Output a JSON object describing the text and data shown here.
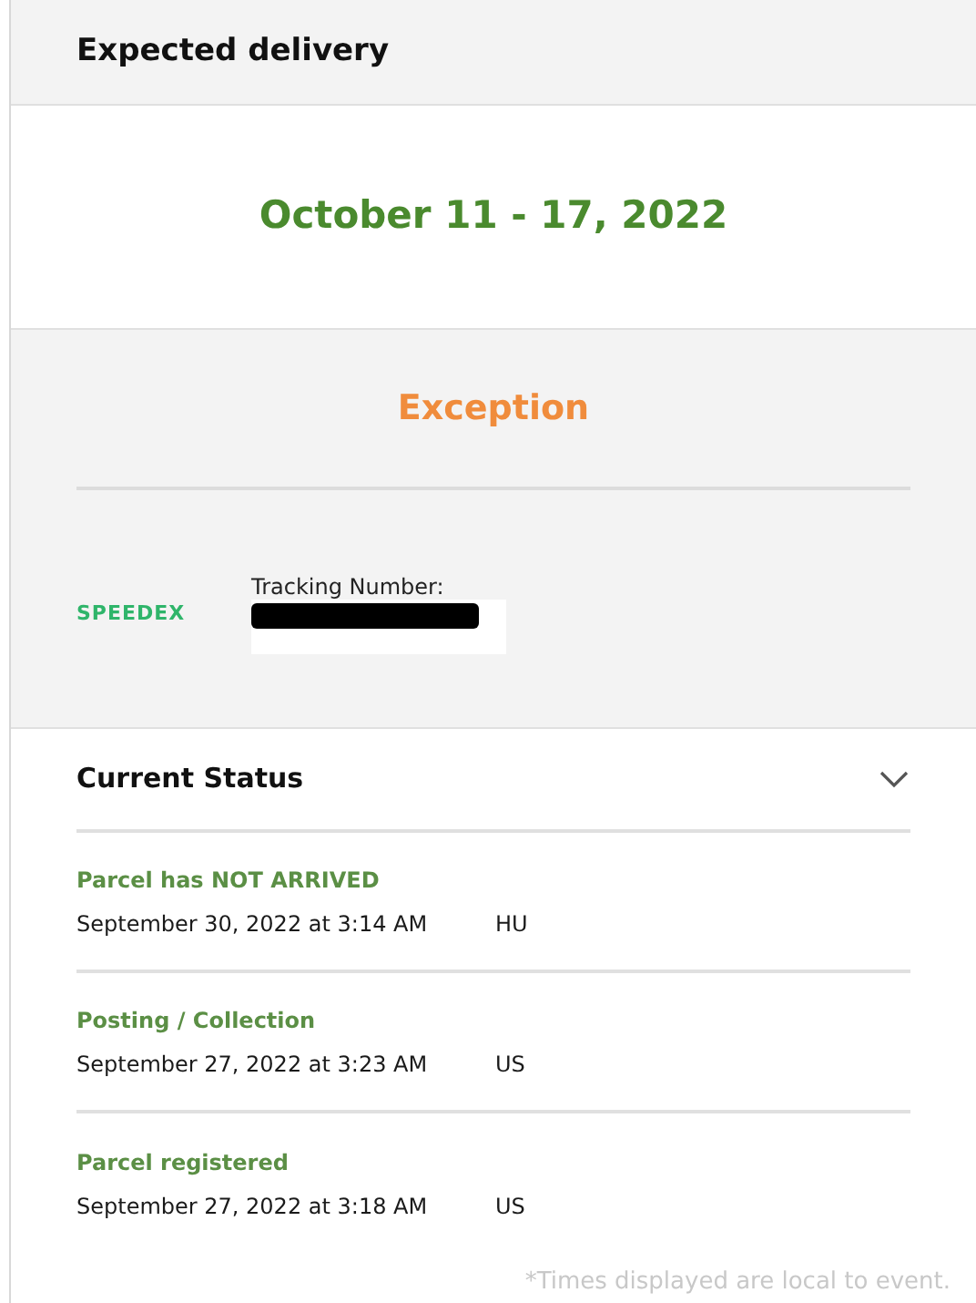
{
  "header": {
    "title": "Expected delivery"
  },
  "delivery_window": "October 11 - 17, 2022",
  "shipment": {
    "status": "Exception",
    "carrier_logo": "SPEEDEX",
    "tracking_label": "Tracking Number:",
    "tracking_redacted": true
  },
  "current_status": {
    "title": "Current Status",
    "expanded": true,
    "events": [
      {
        "title": "Parcel has NOT ARRIVED",
        "time": "September 30, 2022 at 3:14 AM",
        "location": "HU"
      },
      {
        "title": "Posting / Collection",
        "time": "September 27, 2022 at 3:23 AM",
        "location": "US"
      },
      {
        "title": "Parcel registered",
        "time": "September 27, 2022 at 3:18 AM",
        "location": "US"
      }
    ],
    "footnote": "*Times displayed are local to event."
  }
}
